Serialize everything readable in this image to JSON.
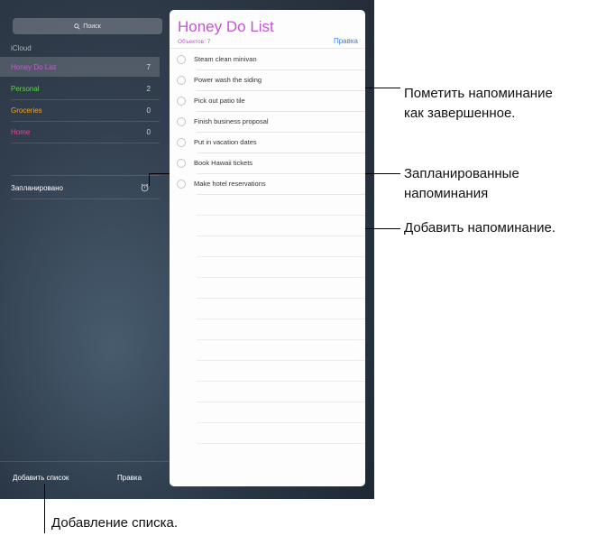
{
  "sidebar": {
    "search_placeholder": "Поиск",
    "section_label": "iCloud",
    "lists": [
      {
        "name": "Honey Do List",
        "count": "7",
        "color": "#c85ad7",
        "selected": true
      },
      {
        "name": "Personal",
        "count": "2",
        "color": "#5fd14a",
        "selected": false
      },
      {
        "name": "Groceries",
        "count": "0",
        "color": "#f2a61d",
        "selected": false
      },
      {
        "name": "Home",
        "count": "0",
        "color": "#f0409a",
        "selected": false
      }
    ],
    "scheduled_label": "Запланировано",
    "scheduled_icon": "alarm-clock-icon",
    "add_list_label": "Добавить список",
    "edit_label": "Правка"
  },
  "detail": {
    "title": "Honey Do List",
    "count_text": "Объектов: 7",
    "edit_label": "Правка",
    "accent_color": "#c255d4",
    "reminders": [
      "Steam clean minivan",
      "Power wash the siding",
      "Pick out patio tile",
      "Finish business proposal",
      "Put in vacation dates",
      "Book Hawaii tickets",
      "Make hotel reservations"
    ]
  },
  "annotations": {
    "mark_complete_line1": "Пометить напоминание",
    "mark_complete_line2": "как завершенное.",
    "scheduled_line1": "Запланированные",
    "scheduled_line2": "напоминания",
    "add_reminder": "Добавить напоминание.",
    "add_list": "Добавление списка."
  }
}
